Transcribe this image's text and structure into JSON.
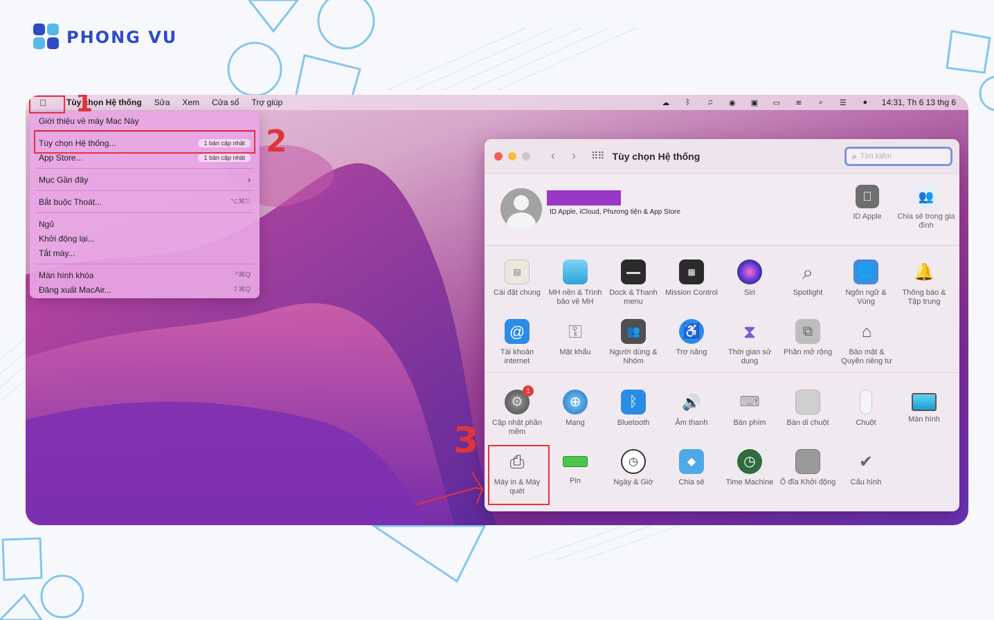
{
  "logo": {
    "text": "PHONG VU"
  },
  "menubar": {
    "app": "Tùy chọn Hệ thống",
    "items": [
      "Sửa",
      "Xem",
      "Cửa sổ",
      "Trợ giúp"
    ],
    "clock": "14:31, Th 6 13 thg 6"
  },
  "apple_menu": {
    "about": "Giới thiệu về máy Mac Này",
    "prefs": "Tùy chọn Hệ thống...",
    "prefs_badge": "1 bản cập nhật",
    "appstore": "App Store...",
    "appstore_badge": "1 bản cập nhật",
    "recent": "Mục Gần đây",
    "force_quit": "Bắt buộc Thoát...",
    "force_quit_short": "⌥⌘⎋",
    "sleep": "Ngủ",
    "restart": "Khởi động lại...",
    "shutdown": "Tắt máy...",
    "lock": "Màn hình khóa",
    "lock_short": "^⌘Q",
    "logout": "Đăng xuất MacAir...",
    "logout_short": "⇧⌘Q"
  },
  "annotations": {
    "step1": "1",
    "step2": "2",
    "step3": "3"
  },
  "prefs": {
    "title": "Tùy chọn Hệ thống",
    "search_placeholder": "Tìm kiếm",
    "account_sub": "ID Apple, iCloud, Phương tiện & App Store",
    "apple_id": "ID Apple",
    "family": "Chia sẻ trong gia đình",
    "row1": [
      {
        "label": "Cài đặt chung"
      },
      {
        "label": "MH nền & Trình bảo vệ MH"
      },
      {
        "label": "Dock & Thanh menu"
      },
      {
        "label": "Mission Control"
      },
      {
        "label": "Siri"
      },
      {
        "label": "Spotlight"
      },
      {
        "label": "Ngôn ngữ & Vùng"
      },
      {
        "label": "Thông báo & Tập trung"
      }
    ],
    "row2": [
      {
        "label": "Tài khoản internet"
      },
      {
        "label": "Mật khẩu"
      },
      {
        "label": "Người dùng & Nhóm"
      },
      {
        "label": "Trợ năng"
      },
      {
        "label": "Thời gian sử dụng"
      },
      {
        "label": "Phần mở rộng"
      },
      {
        "label": "Bảo mật & Quyền riêng tư"
      }
    ],
    "row3": [
      {
        "label": "Cập nhật phần mềm",
        "badge": "1"
      },
      {
        "label": "Mạng"
      },
      {
        "label": "Bluetooth"
      },
      {
        "label": "Âm thanh"
      },
      {
        "label": "Bàn phím"
      },
      {
        "label": "Bàn di chuột"
      },
      {
        "label": "Chuột"
      },
      {
        "label": "Màn hình"
      }
    ],
    "row4": [
      {
        "label": "Máy in & Máy quét"
      },
      {
        "label": "Pin"
      },
      {
        "label": "Ngày & Giờ"
      },
      {
        "label": "Chia sẻ"
      },
      {
        "label": "Time Machine"
      },
      {
        "label": "Ổ đĩa Khởi động"
      },
      {
        "label": "Cấu hình"
      }
    ]
  }
}
